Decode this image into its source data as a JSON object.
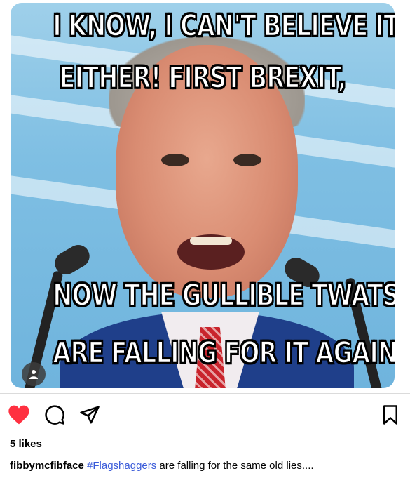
{
  "post": {
    "image": {
      "caption_top_line1": "I KNOW, I CAN'T BELIEVE IT",
      "caption_top_line2": "EITHER! FIRST BREXIT,",
      "caption_bottom_line1": "NOW THE GULLIBLE TWATS",
      "caption_bottom_line2": "ARE FALLING FOR IT AGAIN!"
    },
    "actions": {
      "like_icon": "heart-filled-icon",
      "comment_icon": "comment-icon",
      "share_icon": "send-icon",
      "save_icon": "bookmark-icon",
      "like_color": "#ff3040"
    },
    "likes_text": "5 likes",
    "caption": {
      "username": "fibbymcfibface",
      "hashtag": "#Flagshaggers",
      "text": " are falling for the same old lies...."
    }
  }
}
